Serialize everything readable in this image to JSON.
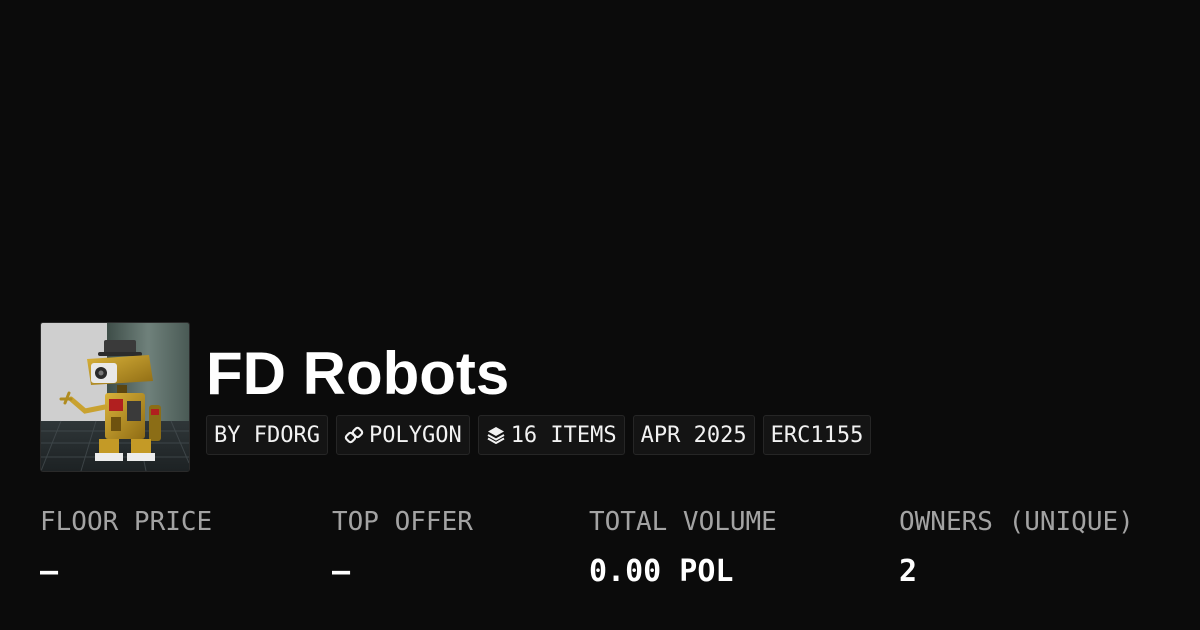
{
  "collection": {
    "title": "FD Robots",
    "image_alt": "FD Robots collection image"
  },
  "tags": {
    "creator": "BY FDORG",
    "chain": "POLYGON",
    "items": "16 ITEMS",
    "date": "APR 2025",
    "standard": "ERC1155"
  },
  "stats": {
    "floor_price": {
      "label": "FLOOR PRICE",
      "value": "—"
    },
    "top_offer": {
      "label": "TOP OFFER",
      "value": "—"
    },
    "total_volume": {
      "label": "TOTAL VOLUME",
      "value": "0.00 POL"
    },
    "owners": {
      "label": "OWNERS (UNIQUE)",
      "value": "2"
    }
  },
  "icons": {
    "chain": "link-icon",
    "items": "layers-icon"
  },
  "colors": {
    "background": "#0b0b0b",
    "tag_background": "#141414",
    "label": "#a3a3a3",
    "text": "#ffffff"
  }
}
